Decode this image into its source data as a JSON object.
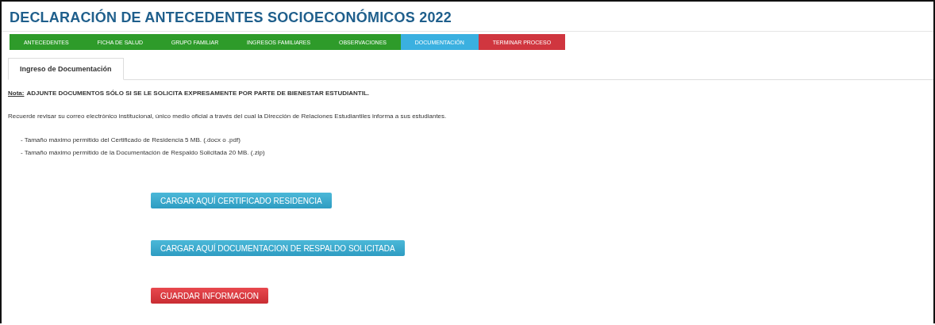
{
  "title": "DECLARACIÓN DE ANTECEDENTES SOCIOECONÓMICOS 2022",
  "nav": [
    {
      "label": "ANTECEDENTES",
      "kind": "step",
      "selected": false
    },
    {
      "label": "FICHA DE SALUD",
      "kind": "step",
      "selected": false
    },
    {
      "label": "GRUPO FAMILIAR",
      "kind": "step",
      "selected": false
    },
    {
      "label": "INGRESOS FAMILIARES",
      "kind": "step",
      "selected": false
    },
    {
      "label": "OBSERVACIONES",
      "kind": "step",
      "selected": false
    },
    {
      "label": "DOCUMENTACIÓN",
      "kind": "step",
      "selected": true
    },
    {
      "label": "TERMINAR PROCESO",
      "kind": "finish",
      "selected": false
    }
  ],
  "subtabs": [
    {
      "label": "Ingreso de Documentación",
      "selected": true
    }
  ],
  "note": {
    "label": "Nota:",
    "text": "ADJUNTE DOCUMENTOS SÓLO SI SE LE SOLICITA EXPRESAMENTE POR PARTE DE BIENESTAR ESTUDIANTIL."
  },
  "reminder": "Recuerde revisar su correo electrónico institucional, único medio oficial a través del cual la Dirección de Relaciones Estudiantiles informa a sus estudiantes.",
  "limits": [
    "- Tamaño máximo permitido del Certificado de Residencia 5 MB. (.docx o .pdf)",
    "- Tamaño máximo permitido de la Documentación de Respaldo Solicitada 20 MB. (.zip)"
  ],
  "buttons": [
    {
      "label": "CARGAR AQUÍ CERTIFICADO RESIDENCIA",
      "kind": "upload"
    },
    {
      "label": "CARGAR AQUÍ DOCUMENTACION DE RESPALDO SOLICITADA",
      "kind": "upload"
    },
    {
      "label": "GUARDAR INFORMACION",
      "kind": "save"
    }
  ]
}
